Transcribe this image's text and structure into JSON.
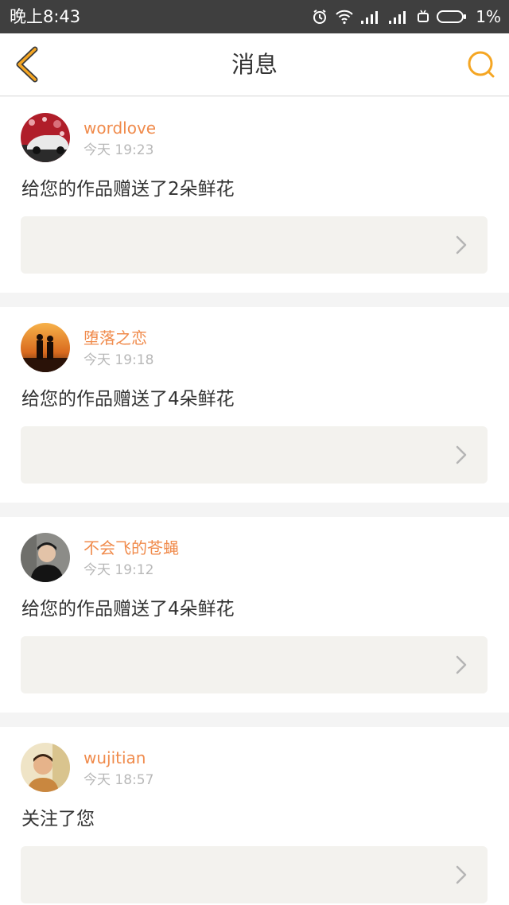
{
  "status_bar": {
    "time": "晚上8:43",
    "battery": "1%",
    "icons": [
      "alarm-icon",
      "wifi-icon",
      "signal-icon",
      "signal-icon",
      "android-icon",
      "battery-icon"
    ]
  },
  "nav": {
    "title": "消息",
    "back_icon": "chevron-left-icon",
    "search_icon": "search-icon",
    "accent_color": "#f5a623"
  },
  "colors": {
    "username": "#f08b4c",
    "timestamp": "#b8b8b8",
    "preview_bg": "#f3f2ee"
  },
  "messages": [
    {
      "user": "wordlove",
      "time": "今天 19:23",
      "text": "给您的作品赠送了2朵鲜花",
      "avatar": "car-avatar"
    },
    {
      "user": "堕落之恋",
      "time": "今天 19:18",
      "text": "给您的作品赠送了4朵鲜花",
      "avatar": "couple-sunset-avatar"
    },
    {
      "user": "不会飞的苍蝇",
      "time": "今天 19:12",
      "text": "给您的作品赠送了4朵鲜花",
      "avatar": "person-avatar"
    },
    {
      "user": "wujitian",
      "time": "今天 18:57",
      "text": "关注了您",
      "avatar": "portrait-avatar"
    }
  ]
}
